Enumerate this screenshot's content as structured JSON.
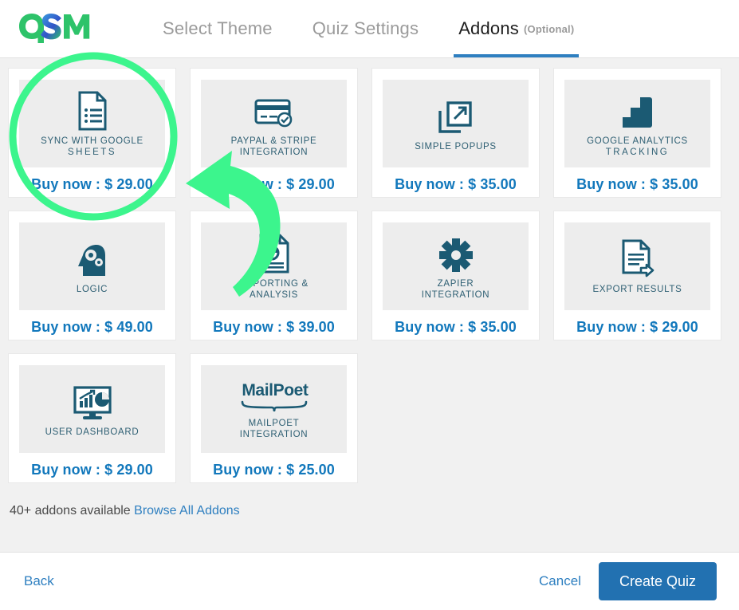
{
  "app": {
    "logo_text": "QSM",
    "logo_colors": {
      "q": "#22c55e",
      "s": "#2e7fc0",
      "m": "#22c55e"
    }
  },
  "tabs": [
    {
      "label": "Select Theme",
      "active": false,
      "optional": ""
    },
    {
      "label": "Quiz Settings",
      "active": false,
      "optional": ""
    },
    {
      "label": "Addons",
      "active": true,
      "optional": "(Optional)"
    }
  ],
  "addons": [
    {
      "icon": "document-list-icon",
      "title_line1": "SYNC WITH GOOGLE",
      "title_line2": "SHEETS",
      "price": "Buy now : $ 29.00"
    },
    {
      "icon": "credit-card-icon",
      "title_line1": "PAYPAL & STRIPE",
      "title_line2": "INTEGRATION",
      "price": "Buy now : $ 29.00"
    },
    {
      "icon": "popup-window-icon",
      "title_line1": "SIMPLE POPUPS",
      "title_line2": "",
      "price": "Buy now : $ 35.00"
    },
    {
      "icon": "analytics-bars-icon",
      "title_line1": "GOOGLE ANALYTICS",
      "title_line2": "TRACKING",
      "price": "Buy now : $ 35.00"
    },
    {
      "icon": "head-gears-icon",
      "title_line1": "LOGIC",
      "title_line2": "",
      "price": "Buy now : $ 49.00"
    },
    {
      "icon": "report-chart-icon",
      "title_line1": "REPORTING &",
      "title_line2": "ANALYSIS",
      "price": "Buy now : $ 39.00"
    },
    {
      "icon": "zapier-asterisk-icon",
      "title_line1": "ZAPIER",
      "title_line2": "INTEGRATION",
      "price": "Buy now : $ 35.00"
    },
    {
      "icon": "export-document-icon",
      "title_line1": "EXPORT RESULTS",
      "title_line2": "",
      "price": "Buy now : $ 29.00"
    },
    {
      "icon": "monitor-charts-icon",
      "title_line1": "USER DASHBOARD",
      "title_line2": "",
      "price": "Buy now : $ 29.00"
    },
    {
      "icon": "mailpoet-logo-icon",
      "title_line1": "MAILPOET",
      "title_line2": "INTEGRATION",
      "price": "Buy now : $ 25.00",
      "wordmark": "MailPoet"
    }
  ],
  "footer_note": {
    "text": "40+ addons available",
    "link": "Browse All Addons"
  },
  "footer": {
    "back": "Back",
    "cancel": "Cancel",
    "create": "Create Quiz"
  },
  "annotation": {
    "highlight_color": "#3cf58d",
    "circle_target": "sync-with-google-sheets card",
    "arrow": "curved arrow pointing to highlighted card"
  },
  "colors": {
    "accent_blue": "#1278bc",
    "tab_active_underline": "#2e7fc0",
    "button_blue": "#2271b1",
    "icon_teal": "#1b5a73",
    "page_bg": "#f1f1f1",
    "tile_bg": "#ededed"
  }
}
